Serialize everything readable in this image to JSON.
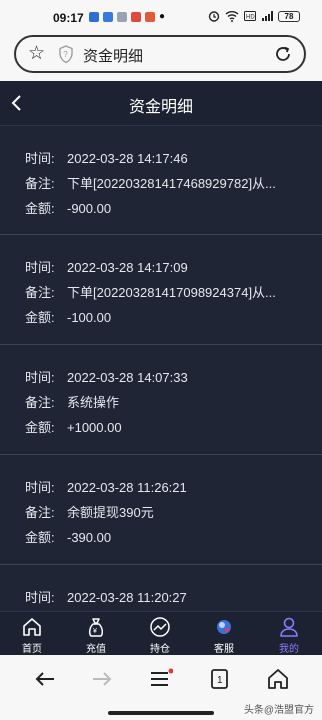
{
  "status": {
    "time": "09:17",
    "battery": "78"
  },
  "browser": {
    "page_name": "资金明细"
  },
  "header": {
    "title": "资金明细"
  },
  "labels": {
    "time": "时间:",
    "note": "备注:",
    "amount": "金额:"
  },
  "records": [
    {
      "time": "2022-03-28 14:17:46",
      "note": "下单[20220328141746892978​2]从...",
      "amount": "-900.00"
    },
    {
      "time": "2022-03-28 14:17:09",
      "note": "下单[20220328141709892437​4]从...",
      "amount": "-100.00"
    },
    {
      "time": "2022-03-28 14:07:33",
      "note": "系统操作",
      "amount": "+1000.00"
    },
    {
      "time": "2022-03-28 11:26:21",
      "note": "余额提现390元",
      "amount": "-390.00"
    },
    {
      "time": "2022-03-28 11:20:27",
      "note": "",
      "amount": ""
    }
  ],
  "tabs": [
    {
      "label": "首页",
      "icon": "home-icon"
    },
    {
      "label": "充值",
      "icon": "money-bag-icon"
    },
    {
      "label": "持仓",
      "icon": "chart-icon"
    },
    {
      "label": "客服",
      "icon": "support-icon"
    },
    {
      "label": "我的",
      "icon": "user-icon"
    }
  ],
  "watermark": "头条@浩盟官方",
  "colors": {
    "header_bg": "#1c2232",
    "content_bg": "#1f2535",
    "accent": "#8a7cff"
  }
}
